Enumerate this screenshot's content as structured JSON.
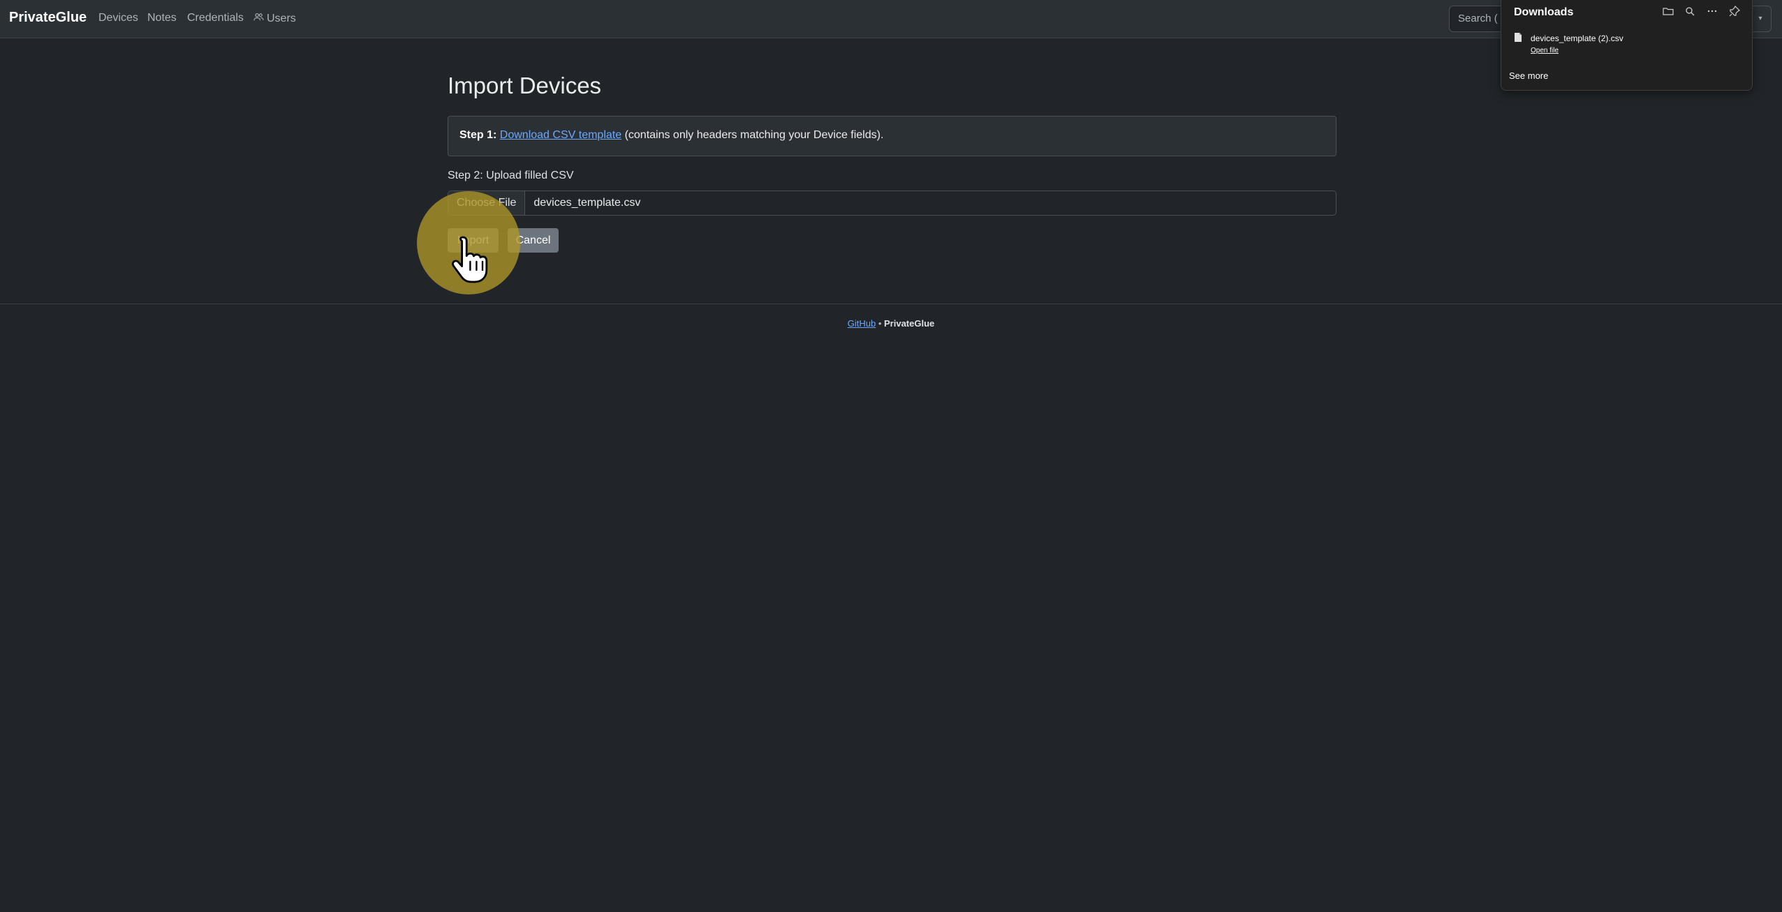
{
  "navbar": {
    "brand": "PrivateGlue",
    "links": [
      "Devices",
      "Notes",
      "Credentials",
      "Users"
    ],
    "search_placeholder": "Search (",
    "dropdown_icon": "chevron-down-icon"
  },
  "page": {
    "title": "Import Devices",
    "step1": {
      "label": "Step 1:",
      "link_text": "Download CSV template",
      "suffix": "(contains only headers matching your Device fields)."
    },
    "step2_label": "Step 2: Upload filled CSV",
    "file_input": {
      "button_label": "Choose File",
      "file_name": "devices_template.csv"
    },
    "buttons": {
      "import": "Import",
      "cancel": "Cancel"
    }
  },
  "footer": {
    "link": "GitHub",
    "separator": "•",
    "brand": "PrivateGlue"
  },
  "downloads": {
    "title": "Downloads",
    "toolbar_icons": [
      "folder-icon",
      "search-icon",
      "more-icon",
      "pin-icon"
    ],
    "items": [
      {
        "file_name": "devices_template (2).csv",
        "action": "Open file"
      }
    ],
    "see_more": "See more"
  },
  "colors": {
    "background": "#212529",
    "navbar": "#2b3035",
    "link": "#6ea8fe",
    "click_halo": "#b09626"
  }
}
